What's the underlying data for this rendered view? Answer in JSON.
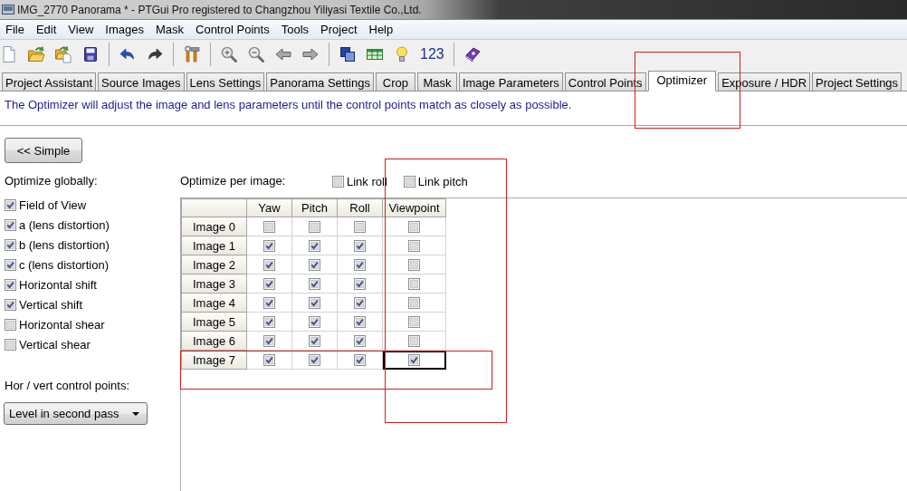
{
  "window": {
    "title": "IMG_2770 Panorama * - PTGui Pro registered to Changzhou Yiliyasi Textile Co.,Ltd."
  },
  "menu": [
    "File",
    "Edit",
    "View",
    "Images",
    "Mask",
    "Control Points",
    "Tools",
    "Project",
    "Help"
  ],
  "toolbar": {
    "text_button": "123"
  },
  "tabs": [
    {
      "label": "Project Assistant",
      "selected": false
    },
    {
      "label": "Source Images",
      "selected": false
    },
    {
      "label": "Lens Settings",
      "selected": false
    },
    {
      "label": "Panorama Settings",
      "selected": false
    },
    {
      "label": "Crop",
      "selected": false
    },
    {
      "label": "Mask",
      "selected": false
    },
    {
      "label": "Image Parameters",
      "selected": false
    },
    {
      "label": "Control Points",
      "selected": false
    },
    {
      "label": "Optimizer",
      "selected": true
    },
    {
      "label": "Exposure / HDR",
      "selected": false
    },
    {
      "label": "Project Settings",
      "selected": false
    }
  ],
  "info_text": "The Optimizer will adjust the image and lens parameters until the control points match as closely as possible.",
  "mode_button": "<< Simple",
  "global": {
    "heading": "Optimize globally:",
    "options": [
      {
        "label": "Field of View",
        "checked": true
      },
      {
        "label": "a (lens distortion)",
        "checked": true
      },
      {
        "label": "b (lens distortion)",
        "checked": true
      },
      {
        "label": "c (lens distortion)",
        "checked": true
      },
      {
        "label": "Horizontal shift",
        "checked": true
      },
      {
        "label": "Vertical shift",
        "checked": true
      },
      {
        "label": "Horizontal shear",
        "checked": false
      },
      {
        "label": "Vertical shear",
        "checked": false
      }
    ]
  },
  "control_points": {
    "label": "Hor / vert control points:",
    "value": "Level in second pass"
  },
  "per_image": {
    "heading": "Optimize per image:",
    "links": [
      {
        "label": "Link roll",
        "checked": false
      },
      {
        "label": "Link pitch",
        "checked": false
      }
    ]
  },
  "table": {
    "columns": [
      "Yaw",
      "Pitch",
      "Roll",
      "Viewpoint"
    ],
    "rows": [
      {
        "label": "Image 0",
        "cells": [
          {
            "checked": false,
            "focused": false
          },
          {
            "checked": false,
            "focused": false
          },
          {
            "checked": false,
            "focused": false
          },
          {
            "checked": false,
            "focused": false
          }
        ]
      },
      {
        "label": "Image 1",
        "cells": [
          {
            "checked": true,
            "focused": false
          },
          {
            "checked": true,
            "focused": false
          },
          {
            "checked": true,
            "focused": false
          },
          {
            "checked": false,
            "focused": false
          }
        ]
      },
      {
        "label": "Image 2",
        "cells": [
          {
            "checked": true,
            "focused": false
          },
          {
            "checked": true,
            "focused": false
          },
          {
            "checked": true,
            "focused": false
          },
          {
            "checked": false,
            "focused": false
          }
        ]
      },
      {
        "label": "Image 3",
        "cells": [
          {
            "checked": true,
            "focused": false
          },
          {
            "checked": true,
            "focused": false
          },
          {
            "checked": true,
            "focused": false
          },
          {
            "checked": false,
            "focused": false
          }
        ]
      },
      {
        "label": "Image 4",
        "cells": [
          {
            "checked": true,
            "focused": false
          },
          {
            "checked": true,
            "focused": false
          },
          {
            "checked": true,
            "focused": false
          },
          {
            "checked": false,
            "focused": false
          }
        ]
      },
      {
        "label": "Image 5",
        "cells": [
          {
            "checked": true,
            "focused": false
          },
          {
            "checked": true,
            "focused": false
          },
          {
            "checked": true,
            "focused": false
          },
          {
            "checked": false,
            "focused": false
          }
        ]
      },
      {
        "label": "Image 6",
        "cells": [
          {
            "checked": true,
            "focused": false
          },
          {
            "checked": true,
            "focused": false
          },
          {
            "checked": true,
            "focused": false
          },
          {
            "checked": false,
            "focused": false
          }
        ]
      },
      {
        "label": "Image 7",
        "cells": [
          {
            "checked": true,
            "focused": false
          },
          {
            "checked": true,
            "focused": false
          },
          {
            "checked": true,
            "focused": false
          },
          {
            "checked": true,
            "focused": true
          }
        ]
      }
    ]
  },
  "annotations": [
    {
      "kind": "rectangle"
    },
    {
      "kind": "rectangle"
    },
    {
      "kind": "rectangle"
    }
  ]
}
